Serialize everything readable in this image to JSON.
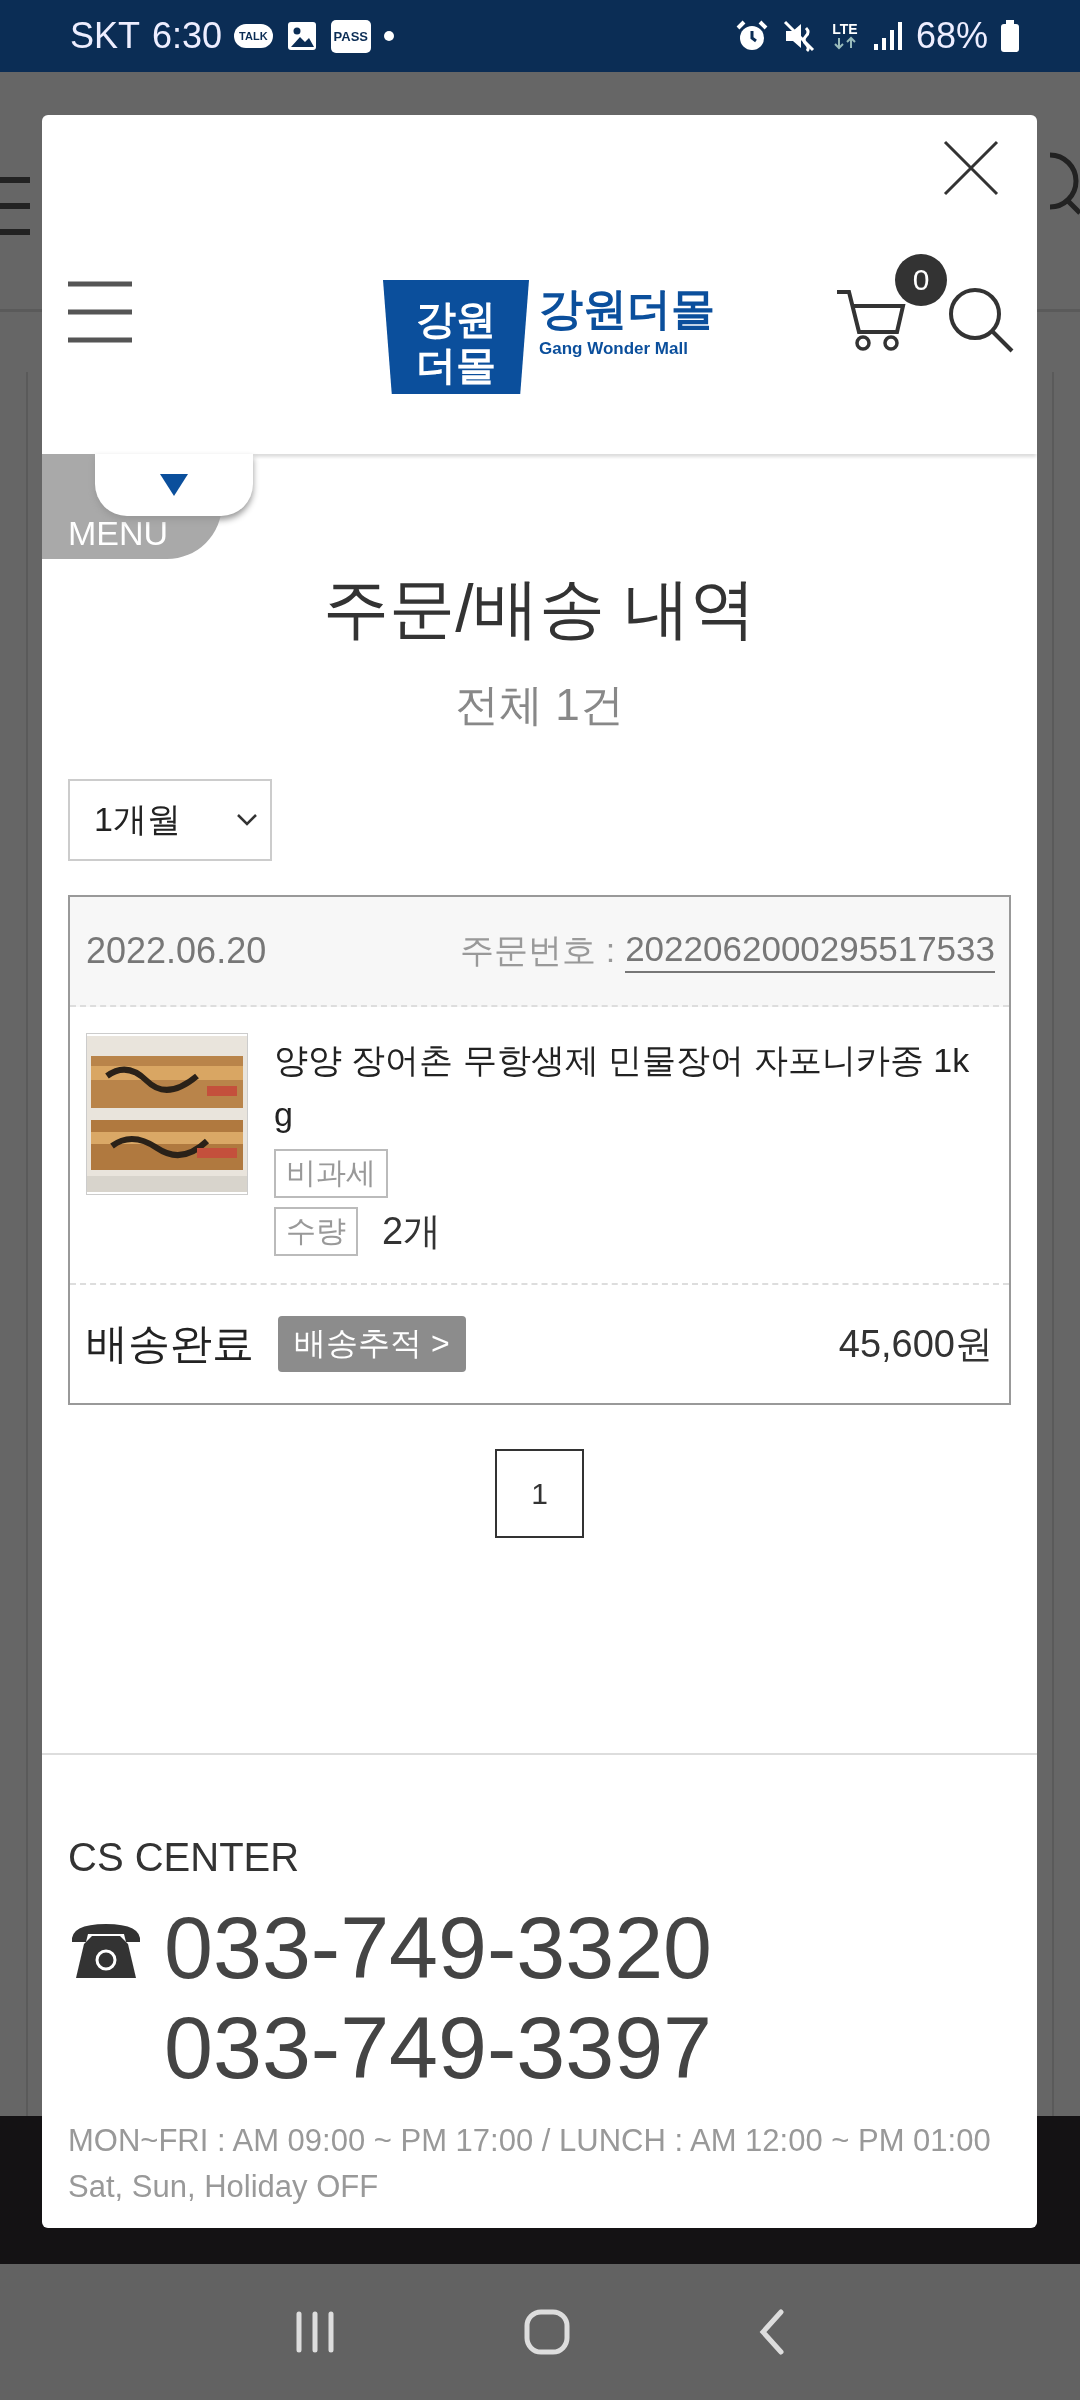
{
  "status_bar": {
    "carrier": "SKT",
    "time": "6:30",
    "talk_badge": "TALK",
    "pass_badge": "PASS",
    "network": "LTE",
    "battery": "68%"
  },
  "modal": {
    "header": {
      "logo_mark": [
        "강원",
        "더몰"
      ],
      "logo_korean": "강원더몰",
      "logo_english": "Gang Wonder Mall",
      "cart_count": "0"
    },
    "menu_tab": "MENU",
    "title": "주문/배송 내역",
    "total": "전체 1건",
    "period_filter": {
      "value": "1개월"
    },
    "orders": [
      {
        "date": "2022.06.20",
        "order_no_label": "주문번호 :",
        "order_no": "2022062000295517533",
        "items": [
          {
            "kind": "picture",
            "name": "양양 장어촌 무항생제 민물장어 자포니카종 1kg",
            "tags": [
              "비과세"
            ],
            "qty_label": "수량",
            "qty": "2개"
          }
        ],
        "status": "배송완료",
        "track_button": "배송추적 >",
        "price": "45,600원"
      }
    ],
    "pagination": [
      {
        "label": "1",
        "selected": true
      }
    ],
    "cs": {
      "title": "CS CENTER",
      "phones": [
        "033-749-3320",
        "033-749-3397"
      ],
      "hours": [
        "MON~FRI : AM 09:00 ~ PM 17:00 / LUNCH : AM 12:00 ~ PM 01:00",
        "Sat, Sun, Holiday OFF"
      ]
    }
  }
}
